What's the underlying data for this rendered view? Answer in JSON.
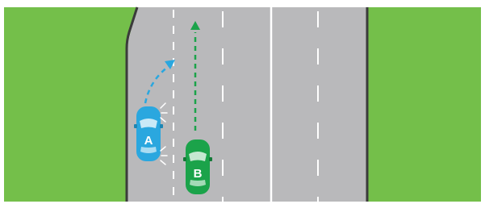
{
  "scene": {
    "road_color": "#b9b9bb",
    "grass_color": "#74bf4a",
    "curb_color": "#3b3b3b",
    "lane_marking_color": "#ffffff"
  },
  "cars": {
    "a": {
      "label": "A",
      "color": "#2aa7df",
      "path_color": "#2aa7df",
      "maneuver": "curved-merge-left",
      "signal": "left-indicator-flashing"
    },
    "b": {
      "label": "B",
      "color": "#1ba34a",
      "path_color": "#1ba34a",
      "maneuver": "straight-ahead"
    }
  }
}
